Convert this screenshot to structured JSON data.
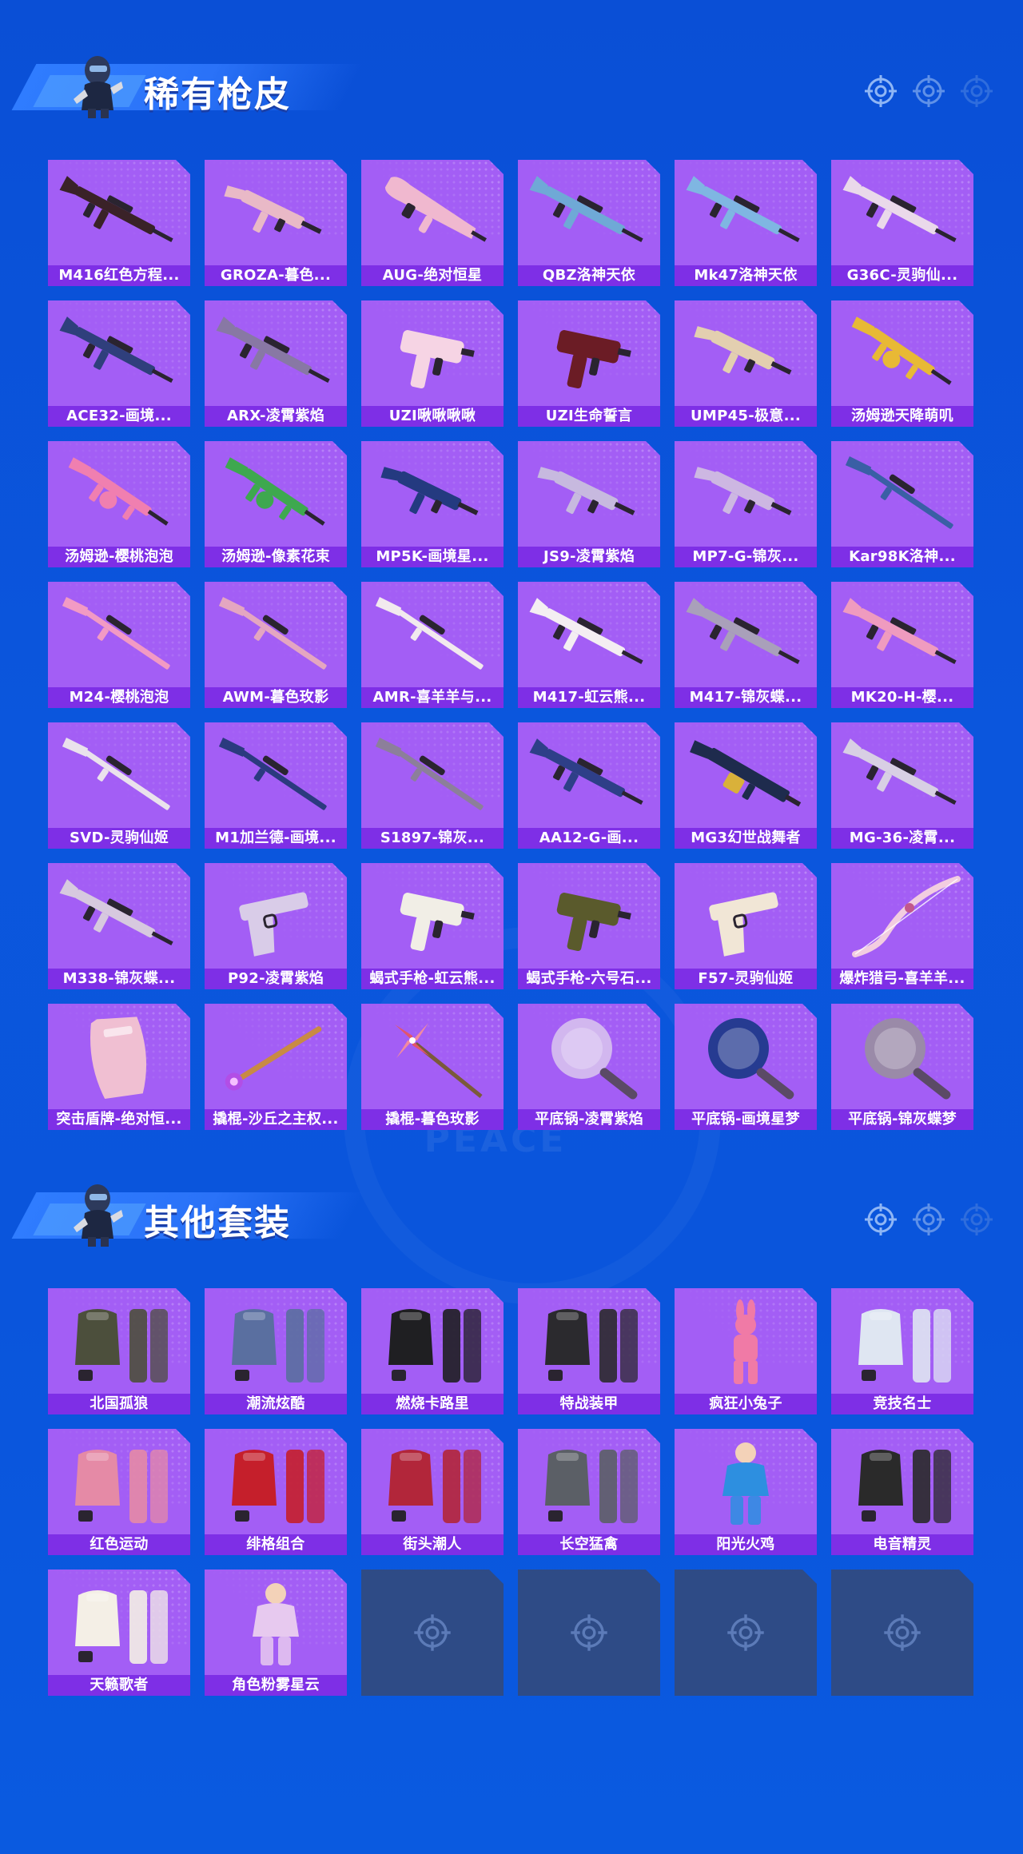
{
  "sections": [
    {
      "title": "稀有枪皮",
      "items": [
        {
          "label": "M416红色方程...",
          "kind": "rifle",
          "color": "#3a2228"
        },
        {
          "label": "GROZA-暮色...",
          "kind": "smg",
          "color": "#e9b9c7"
        },
        {
          "label": "AUG-绝对恒星",
          "kind": "bullpup",
          "color": "#f0b8cf"
        },
        {
          "label": "QBZ洛神天依",
          "kind": "rifle",
          "color": "#6fa9d6"
        },
        {
          "label": "Mk47洛神天依",
          "kind": "rifle",
          "color": "#7fb6e2"
        },
        {
          "label": "G36C-灵驹仙...",
          "kind": "rifle",
          "color": "#ead9ea"
        },
        {
          "label": "ACE32-画境...",
          "kind": "rifle",
          "color": "#2f3f7c"
        },
        {
          "label": "ARX-凌霄紫焰",
          "kind": "rifle",
          "color": "#8878a4"
        },
        {
          "label": "UZI啾啾啾啾",
          "kind": "uzi",
          "color": "#f6d4e4"
        },
        {
          "label": "UZI生命誓言",
          "kind": "uzi",
          "color": "#6b1c25"
        },
        {
          "label": "UMP45-极意...",
          "kind": "smg",
          "color": "#e3cfb0"
        },
        {
          "label": "汤姆逊天降萌叽",
          "kind": "tommy",
          "color": "#e8b935"
        },
        {
          "label": "汤姆逊-樱桃泡泡",
          "kind": "tommy",
          "color": "#f07fb0"
        },
        {
          "label": "汤姆逊-像素花束",
          "kind": "tommy",
          "color": "#3ea84f"
        },
        {
          "label": "MP5K-画境星...",
          "kind": "smg",
          "color": "#243a80"
        },
        {
          "label": "JS9-凌霄紫焰",
          "kind": "smg",
          "color": "#c7b9df"
        },
        {
          "label": "MP7-G-锦灰...",
          "kind": "smg",
          "color": "#cdb7e2"
        },
        {
          "label": "Kar98K洛神...",
          "kind": "sniper",
          "color": "#3a5fa5"
        },
        {
          "label": "M24-樱桃泡泡",
          "kind": "sniper",
          "color": "#f29ac4"
        },
        {
          "label": "AWM-暮色玫影",
          "kind": "sniper",
          "color": "#e4a6c1"
        },
        {
          "label": "AMR-喜羊羊与...",
          "kind": "sniper",
          "color": "#f2e9ee"
        },
        {
          "label": "M417-虹云熊...",
          "kind": "rifle",
          "color": "#f4eef2"
        },
        {
          "label": "M417-锦灰蝶...",
          "kind": "rifle",
          "color": "#a9a0ba"
        },
        {
          "label": "MK20-H-樱...",
          "kind": "rifle",
          "color": "#ef9bbf"
        },
        {
          "label": "SVD-灵驹仙姬",
          "kind": "sniper",
          "color": "#eae2ec"
        },
        {
          "label": "M1加兰德-画境...",
          "kind": "sniper",
          "color": "#2b3a7f"
        },
        {
          "label": "S1897-锦灰...",
          "kind": "sniper",
          "color": "#8c7f9a"
        },
        {
          "label": "AA12-G-画...",
          "kind": "rifle",
          "color": "#2e3f88"
        },
        {
          "label": "MG3幻世战舞者",
          "kind": "lmg",
          "color": "#1e2b4d"
        },
        {
          "label": "MG-36-凌霄...",
          "kind": "rifle",
          "color": "#d8cfe4"
        },
        {
          "label": "M338-锦灰蝶...",
          "kind": "rifle",
          "color": "#d7c9df"
        },
        {
          "label": "P92-凌霄紫焰",
          "kind": "pistol",
          "color": "#d9cce8"
        },
        {
          "label": "蝎式手枪-虹云熊...",
          "kind": "uzi",
          "color": "#f1eee6"
        },
        {
          "label": "蝎式手枪-六号石...",
          "kind": "uzi",
          "color": "#5a5a2c"
        },
        {
          "label": "F57-灵驹仙姬",
          "kind": "pistol",
          "color": "#f1e6d6"
        },
        {
          "label": "爆炸猎弓-喜羊羊...",
          "kind": "bow",
          "color": "#f2cde0"
        },
        {
          "label": "突击盾牌-绝对恒...",
          "kind": "shield",
          "color": "#f0bfd2"
        },
        {
          "label": "撬棍-沙丘之主权...",
          "kind": "staff",
          "color": "#c98a43"
        },
        {
          "label": "撬棍-暮色玫影",
          "kind": "pinwheel",
          "color": "#e2556b"
        },
        {
          "label": "平底锅-凌霄紫焰",
          "kind": "pan",
          "color": "#d2b7ef"
        },
        {
          "label": "平底锅-画境星梦",
          "kind": "pan",
          "color": "#263b91"
        },
        {
          "label": "平底锅-锦灰蝶梦",
          "kind": "pan",
          "color": "#9a8aa8"
        }
      ]
    },
    {
      "title": "其他套装",
      "items": [
        {
          "label": "北国孤狼",
          "kind": "outfit",
          "color": "#4c4f3c"
        },
        {
          "label": "潮流炫酷",
          "kind": "outfit",
          "color": "#5a6fa0"
        },
        {
          "label": "燃烧卡路里",
          "kind": "outfit",
          "color": "#1f1f22"
        },
        {
          "label": "特战装甲",
          "kind": "outfit",
          "color": "#2b2a2e"
        },
        {
          "label": "疯狂小兔子",
          "kind": "bunny",
          "color": "#f07aa6"
        },
        {
          "label": "竞技名士",
          "kind": "outfit",
          "color": "#dfe6f2"
        },
        {
          "label": "红色运动",
          "kind": "outfit",
          "color": "#e58aa6"
        },
        {
          "label": "绯格组合",
          "kind": "outfit",
          "color": "#c51f2b"
        },
        {
          "label": "街头潮人",
          "kind": "outfit",
          "color": "#b2263a"
        },
        {
          "label": "长空猛禽",
          "kind": "outfit",
          "color": "#5b5f66"
        },
        {
          "label": "阳光火鸡",
          "kind": "figure",
          "color": "#2d8fe0"
        },
        {
          "label": "电音精灵",
          "kind": "outfit",
          "color": "#2a2a2a"
        },
        {
          "label": "天籁歌者",
          "kind": "outfit",
          "color": "#f4efe6"
        },
        {
          "label": "角色粉雾星云",
          "kind": "figure",
          "color": "#e7c9ef"
        }
      ],
      "empty_slots": 4
    }
  ],
  "watermark": "GAME FOR PEACE",
  "colors": {
    "background": "#0a52d9",
    "card": "#a35ef5",
    "label_bar": "#7e2fe6",
    "empty_card": "#2e4b86",
    "header_band": "#2f7cff"
  },
  "icons": {
    "header_avatar": "soldier-mascot-icon",
    "header_decor": "crosshair-icon",
    "empty_slot": "crosshair-icon"
  }
}
